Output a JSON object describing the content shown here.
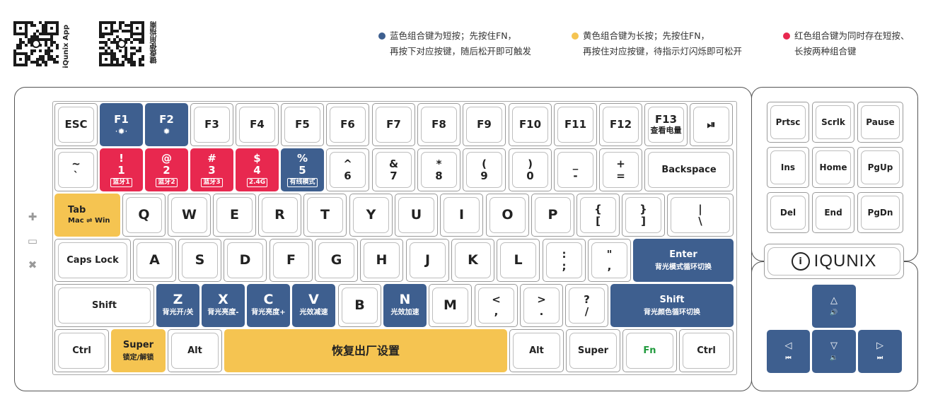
{
  "qr": {
    "app_caption": "iQunix App",
    "guide_caption": "键盘使用指南"
  },
  "legend": {
    "blue": {
      "color": "#3e5f8f",
      "line1": "蓝色组合键为短按；先按住FN，",
      "line2": "再按下对应按键，随后松开即可触发"
    },
    "yellow": {
      "color": "#f5c451",
      "line1": "黄色组合键为长按；先按住FN，",
      "line2": "再按住对应按键，待指示灯闪烁即可松开"
    },
    "red": {
      "color": "#e8284f",
      "line1": "红色组合键为同时存在短按、",
      "line2": "长按两种组合键"
    }
  },
  "colors": {
    "blue": "#3e5f8f",
    "red": "#e8284f",
    "yellow": "#f5c451",
    "green": "#1f9a3c"
  },
  "brand": {
    "logo_text": "IQUNIX",
    "logo_mark": "i"
  },
  "side_icons": [
    "plus-icon",
    "minus-icon",
    "cross-icon"
  ],
  "keys": {
    "esc": "ESC",
    "f1": "F1",
    "f1_sym": "·✹·",
    "f2": "F2",
    "f2_sym": "✹",
    "f3": "F3",
    "f4": "F4",
    "f5": "F5",
    "f6": "F6",
    "f7": "F7",
    "f8": "F8",
    "f9": "F9",
    "f10": "F10",
    "f11": "F11",
    "f12": "F12",
    "f13": "F13",
    "f13_sub": "查看电量",
    "play": "⏯",
    "tilde_top": "~",
    "tilde_bot": "`",
    "k1_top": "!",
    "k1_bot": "1",
    "k1_tag": "蓝牙1",
    "k2_top": "@",
    "k2_bot": "2",
    "k2_tag": "蓝牙2",
    "k3_top": "#",
    "k3_bot": "3",
    "k3_tag": "蓝牙3",
    "k4_top": "$",
    "k4_bot": "4",
    "k4_tag": "2.4G",
    "k5_top": "%",
    "k5_bot": "5",
    "k5_tag": "有线模式",
    "k6_top": "^",
    "k6_bot": "6",
    "k7_top": "&",
    "k7_bot": "7",
    "k8_top": "*",
    "k8_bot": "8",
    "k9_top": "(",
    "k9_bot": "9",
    "k0_top": ")",
    "k0_bot": "0",
    "minus_top": "_",
    "minus_bot": "-",
    "equal_top": "+",
    "equal_bot": "=",
    "backspace": "Backspace",
    "tab": "Tab",
    "tab_sub": "Mac ⇌ Win",
    "q": "Q",
    "w": "W",
    "e": "E",
    "r": "R",
    "t": "T",
    "y": "Y",
    "u": "U",
    "i": "I",
    "o": "O",
    "p": "P",
    "lbracket_top": "{",
    "lbracket_bot": "[",
    "rbracket_top": "}",
    "rbracket_bot": "]",
    "backslash_top": "|",
    "backslash_bot": "\\",
    "caps": "Caps Lock",
    "a": "A",
    "s": "S",
    "d": "D",
    "f": "F",
    "g": "G",
    "h": "H",
    "j": "J",
    "k": "K",
    "l": "L",
    "semicolon_top": ":",
    "semicolon_bot": ";",
    "quote_top": "\"",
    "quote_bot": ",",
    "enter": "Enter",
    "enter_sub": "背光模式循环切换",
    "lshift": "Shift",
    "z": "Z",
    "z_sub": "背光开/关",
    "x": "X",
    "x_sub": "背光亮度-",
    "c": "C",
    "c_sub": "背光亮度+",
    "v": "V",
    "v_sub": "光效减速",
    "b": "B",
    "n": "N",
    "n_sub": "光效加速",
    "m": "M",
    "comma_top": "<",
    "comma_bot": ",",
    "period_top": ">",
    "period_bot": ".",
    "slash_top": "?",
    "slash_bot": "/",
    "rshift": "Shift",
    "rshift_sub": "背光颜色循环切换",
    "lctrl": "Ctrl",
    "lsuper": "Super",
    "lsuper_sub": "锁定/解锁",
    "lalt": "Alt",
    "space": "恢复出厂设置",
    "ralt": "Alt",
    "rsuper": "Super",
    "fn": "Fn",
    "rctrl": "Ctrl",
    "prtsc": "Prtsc",
    "scrlk": "Scrlk",
    "pause": "Pause",
    "ins": "Ins",
    "home": "Home",
    "pgup": "PgUp",
    "del": "Del",
    "end": "End",
    "pgdn": "PgDn",
    "up": "△",
    "up_sub": "🔊",
    "left": "◁",
    "left_sub": "⏮",
    "down": "▽",
    "down_sub": "🔉",
    "right": "▷",
    "right_sub": "⏭"
  }
}
